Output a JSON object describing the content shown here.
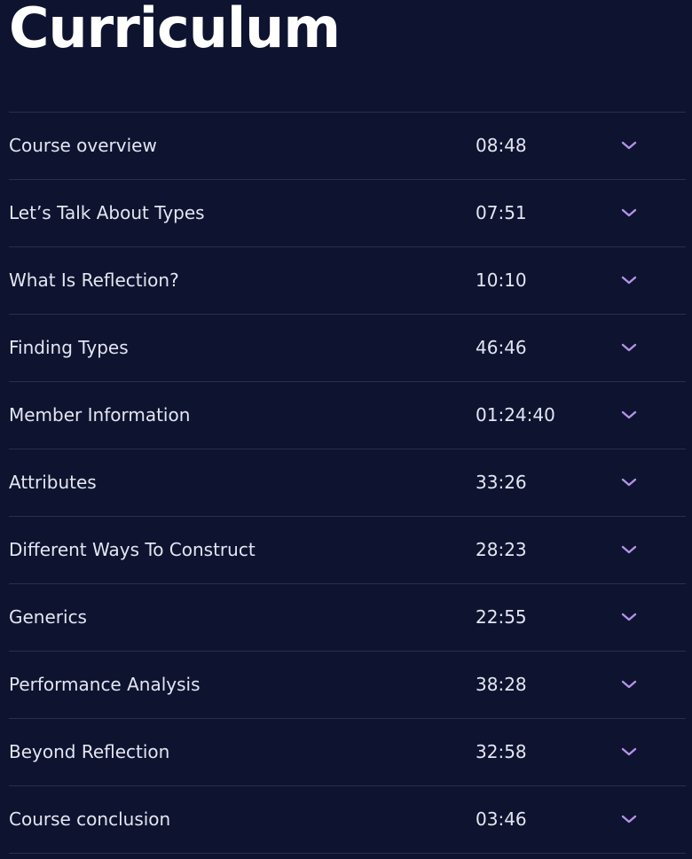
{
  "page": {
    "title": "Curriculum"
  },
  "colors": {
    "background": "#0e1330",
    "text": "#e3e6f1",
    "heading": "#ffffff",
    "divider": "#273050",
    "chevron": "#b592e6"
  },
  "curriculum": {
    "toggle_icon": "chevron-down-icon",
    "sections": [
      {
        "title": "Course overview",
        "duration": "08:48"
      },
      {
        "title": "Let’s Talk About Types",
        "duration": "07:51"
      },
      {
        "title": "What Is Reflection?",
        "duration": "10:10"
      },
      {
        "title": "Finding Types",
        "duration": "46:46"
      },
      {
        "title": "Member Information",
        "duration": "01:24:40"
      },
      {
        "title": "Attributes",
        "duration": "33:26"
      },
      {
        "title": "Different Ways To Construct",
        "duration": "28:23"
      },
      {
        "title": "Generics",
        "duration": "22:55"
      },
      {
        "title": "Performance Analysis",
        "duration": "38:28"
      },
      {
        "title": "Beyond Reflection",
        "duration": "32:58"
      },
      {
        "title": "Course conclusion",
        "duration": "03:46"
      }
    ]
  }
}
